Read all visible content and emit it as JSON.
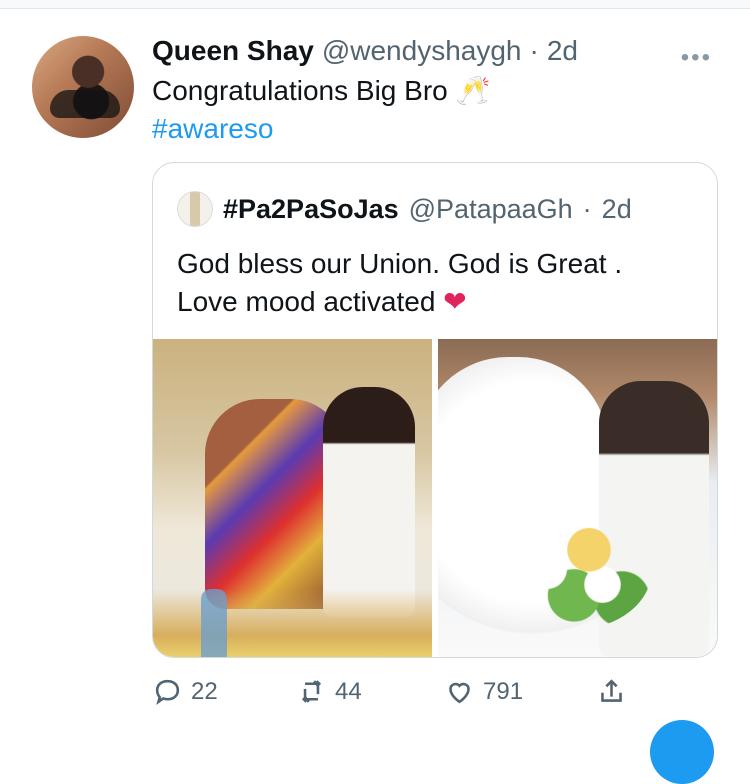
{
  "tweet": {
    "name": "Queen Shay",
    "handle": "@wendyshaygh",
    "dot": "·",
    "time": "2d",
    "more": "•••",
    "text": "Congratulations Big Bro",
    "emoji": "🥂",
    "hashtag": "#awareso"
  },
  "quote": {
    "name": "#Pa2PaSoJas",
    "handle": "@PatapaaGh",
    "dot": "·",
    "time": "2d",
    "line1": "God bless our Union. God is Great .",
    "line2": "Love mood activated",
    "heart": "❤"
  },
  "actions": {
    "reply_count": "22",
    "retweet_count": "44",
    "like_count": "791"
  },
  "icons": {
    "reply": "reply-icon",
    "retweet": "retweet-icon",
    "like": "like-icon",
    "share": "share-icon",
    "more": "more-icon"
  }
}
